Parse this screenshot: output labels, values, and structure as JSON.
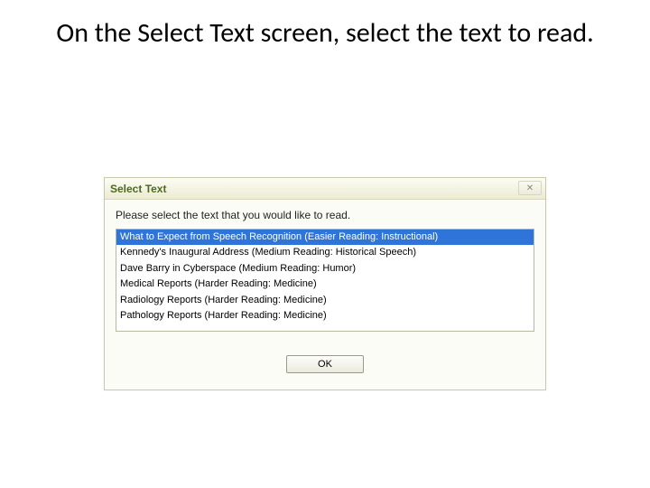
{
  "slide": {
    "title": "On the Select Text screen, select the text to read."
  },
  "dialog": {
    "title": "Select Text",
    "close_glyph": "✕",
    "instruction": "Please select the text that you would like to read.",
    "items": [
      "What to Expect from Speech Recognition (Easier Reading: Instructional)",
      "Kennedy's Inaugural Address (Medium Reading: Historical Speech)",
      "Dave Barry in Cyberspace (Medium Reading: Humor)",
      "Medical Reports (Harder Reading: Medicine)",
      "Radiology Reports (Harder Reading: Medicine)",
      "Pathology Reports (Harder Reading: Medicine)"
    ],
    "selected_index": 0,
    "ok_label": "OK"
  }
}
